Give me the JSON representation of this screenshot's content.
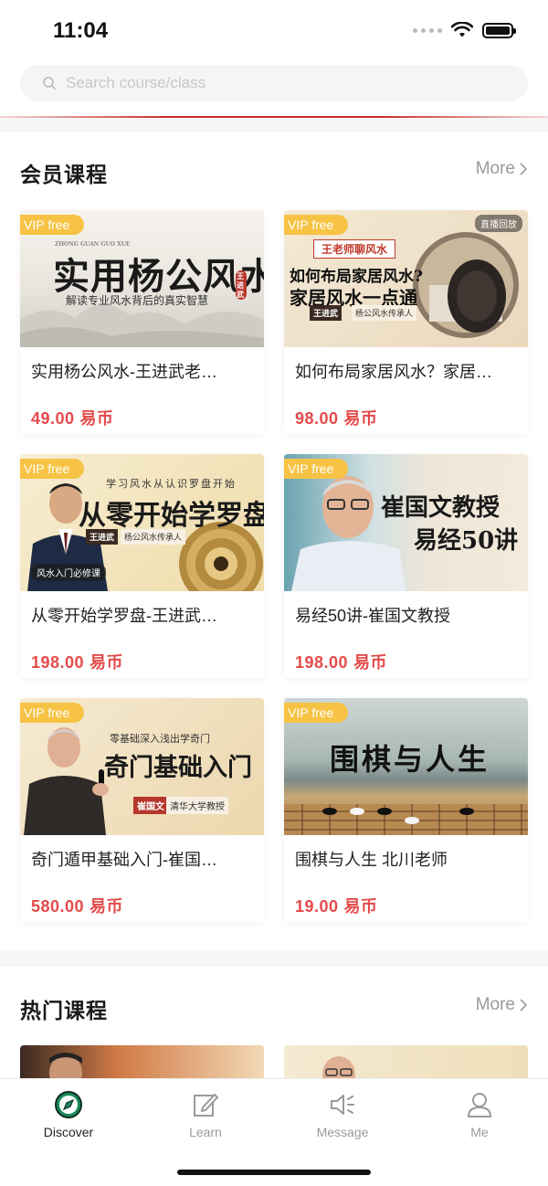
{
  "status_bar": {
    "time": "11:04"
  },
  "search": {
    "placeholder": "Search course/class"
  },
  "sections": {
    "member": {
      "title": "会员课程",
      "more": "More"
    },
    "hot": {
      "title": "热门课程",
      "more": "More"
    }
  },
  "badge": {
    "vip": "VIP free"
  },
  "courses": [
    {
      "title": "实用杨公风水-王进武老…",
      "price": "49.00",
      "currency": "易币",
      "thumb": {
        "main": "实用杨公风水",
        "sub": "解读专业风水背后的真实智慧",
        "pinyin": "ZHONG GUAN GUO XUE",
        "seal": "王进武"
      }
    },
    {
      "title": "如何布局家居风水？家居…",
      "price": "98.00",
      "currency": "易币",
      "thumb": {
        "tag": "王老师聊风水",
        "line1": "如何布局家居风水?",
        "line2": "家居风水一点通",
        "name": "王进武",
        "role": "杨公风水传承人",
        "live": "直播回放"
      }
    },
    {
      "title": "从零开始学罗盘-王进武…",
      "price": "198.00",
      "currency": "易币",
      "thumb": {
        "top": "学习风水从认识罗盘开始",
        "main": "从零开始学罗盘",
        "name": "王进武",
        "role": "杨公风水传承人",
        "tag": "风水入门必修课"
      }
    },
    {
      "title": "易经50讲-崔国文教授",
      "price": "198.00",
      "currency": "易币",
      "thumb": {
        "line1": "崔国文教授",
        "line2": "易经50讲"
      }
    },
    {
      "title": "奇门遁甲基础入门-崔国…",
      "price": "580.00",
      "currency": "易币",
      "thumb": {
        "top": "零基础深入浅出学奇门",
        "main": "奇门基础入门",
        "name": "崔国文",
        "role": "清华大学教授"
      }
    },
    {
      "title": "围棋与人生  北川老师",
      "price": "19.00",
      "currency": "易币",
      "thumb": {
        "main": "围棋与人生"
      }
    }
  ],
  "tabs": [
    {
      "label": "Discover",
      "icon": "compass-icon"
    },
    {
      "label": "Learn",
      "icon": "edit-note-icon"
    },
    {
      "label": "Message",
      "icon": "speaker-icon"
    },
    {
      "label": "Me",
      "icon": "user-icon"
    }
  ],
  "colors": {
    "price": "#e34b4b",
    "vip": "#f6c344",
    "accent": "#c9302c",
    "discover": "#1a8a5a"
  }
}
